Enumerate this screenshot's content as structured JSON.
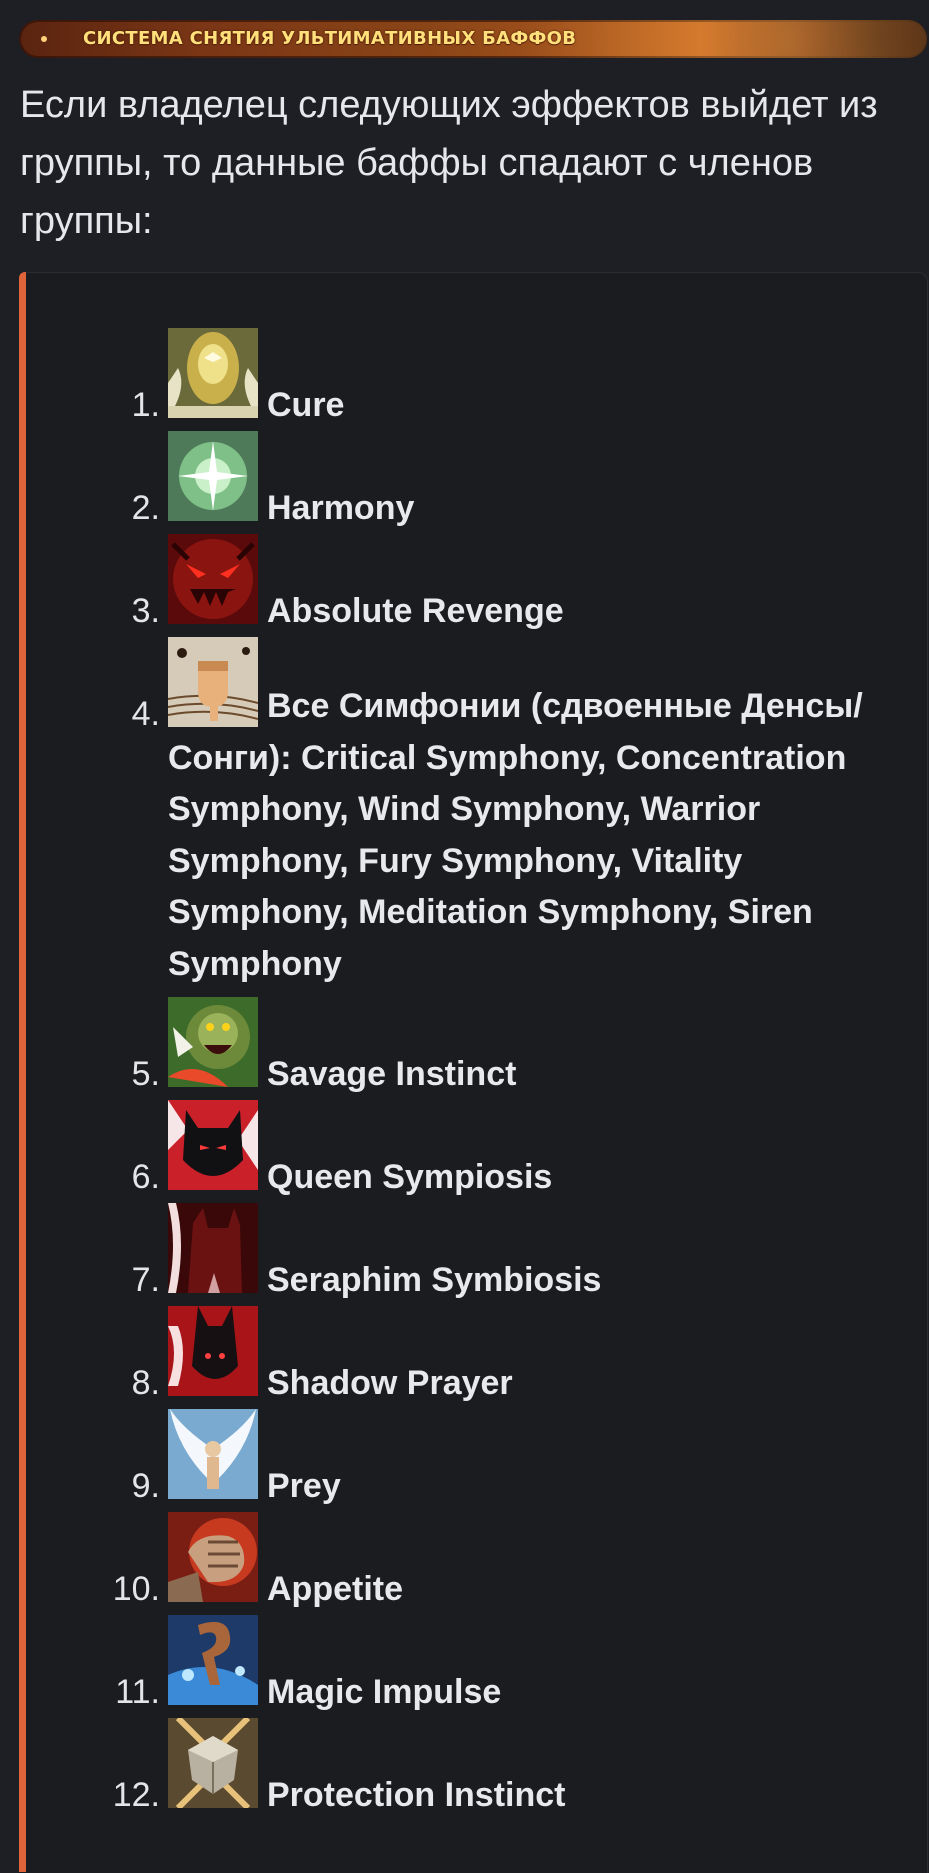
{
  "banner": {
    "title": "СИСТЕМА СНЯТИЯ УЛЬТИМАТИВНЫХ БАФФОВ"
  },
  "intro": "Если владелец следующих эффектов выйдет из группы, то данные баффы спадают с членов группы:",
  "items": [
    {
      "number": "1.",
      "name": "Cure",
      "icon": "cure-icon"
    },
    {
      "number": "2.",
      "name": "Harmony",
      "icon": "harmony-icon"
    },
    {
      "number": "3.",
      "name": "Absolute Revenge",
      "icon": "absolute-revenge-icon"
    },
    {
      "number": "4.",
      "name": "Все Симфонии (сдвоенные Денсы/Сонги): Critical Symphony, Concentration Symphony, Wind Symphony, Warrior Symphony, Fury Symphony, Vitality Symphony, Meditation Symphony, Siren Symphony",
      "icon": "symphony-icon"
    },
    {
      "number": "5.",
      "name": "Savage Instinct",
      "icon": "savage-instinct-icon"
    },
    {
      "number": "6.",
      "name": "Queen Sympiosis",
      "icon": "queen-symbiosis-icon"
    },
    {
      "number": "7.",
      "name": "Seraphim Symbiosis",
      "icon": "seraphim-symbiosis-icon"
    },
    {
      "number": "8.",
      "name": "Shadow Prayer",
      "icon": "shadow-prayer-icon"
    },
    {
      "number": "9.",
      "name": "Prey",
      "icon": "prey-icon"
    },
    {
      "number": "10.",
      "name": "Appetite",
      "icon": "appetite-icon"
    },
    {
      "number": "11.",
      "name": "Magic Impulse",
      "icon": "magic-impulse-icon"
    },
    {
      "number": "12.",
      "name": "Protection Instinct",
      "icon": "protection-instinct-icon"
    }
  ]
}
